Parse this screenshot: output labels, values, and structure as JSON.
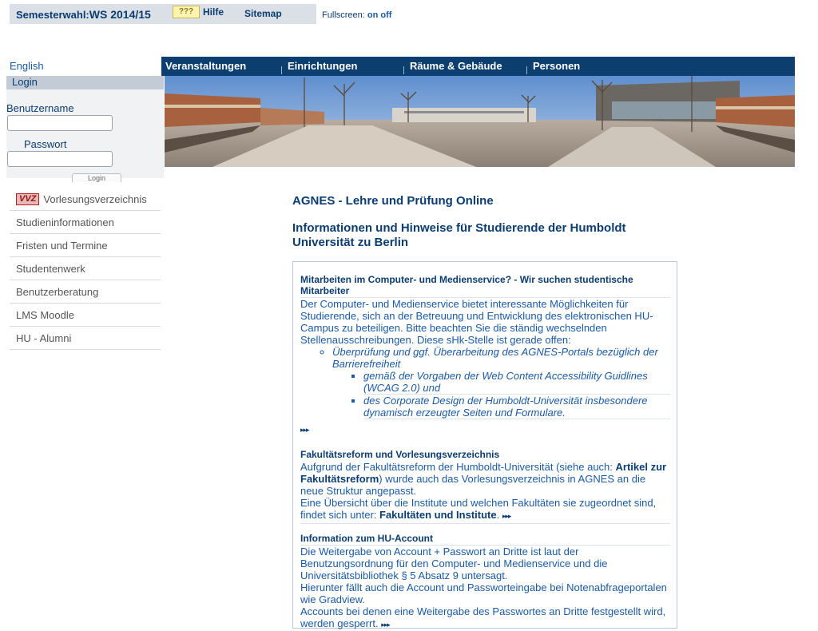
{
  "topbar": {
    "semester_label": "Semesterwahl:",
    "semester_value": "WS 2014/15",
    "help_badge": "???",
    "help_label": "Hilfe",
    "sitemap_label": "Sitemap",
    "fullscreen_label": "Fullscreen:",
    "fullscreen_on": "on",
    "fullscreen_off": "off"
  },
  "language": "English",
  "login": {
    "title": "Login",
    "username_label": "Benutzername",
    "password_label": "Passwort",
    "button_label": "Login"
  },
  "sidenav": {
    "vvz_badge": "VVZ",
    "items": [
      "Vorlesungsverzeichnis",
      "Studieninformationen",
      "Fristen und Termine",
      "Studentenwerk",
      "Benutzerberatung",
      "LMS Moodle",
      "HU - Alumni"
    ]
  },
  "mainnav": [
    "Veranstaltungen",
    "Einrichtungen",
    "Räume & Gebäude",
    "Personen"
  ],
  "content": {
    "title": "AGNES - Lehre und Prüfung Online",
    "subtitle": "Informationen und Hinweise für Studierende der Humboldt Universität zu Berlin"
  },
  "news": [
    {
      "title": "Mitarbeiten im Computer- und Medienservice? - Wir suchen studentische Mitarbeiter",
      "text": "Der Computer- und Medienservice bietet interessante Möglichkeiten für Studierende, sich an der Betreuung und Entwicklung des elektronischen HU-Campus zu beteiligen. Bitte beachten Sie die ständig wechselnden Stellenausschreibungen. Diese sHk-Stelle ist gerade offen:",
      "list_item": "Überprüfung und ggf. Überarbeitung des AGNES-Portals bezüglich der Barrierefreiheit",
      "sub_items": [
        "gemäß der Vorgaben der Web Content Accessibility Guidlines (WCAG 2.0) und",
        "des Corporate Design der Humboldt-Universität insbesondere dynamisch erzeugter Seiten und Formulare."
      ]
    },
    {
      "title": "Fakultätsreform und Vorlesungsverzeichnis",
      "text1": "Aufgrund der Fakultätsreform der Humboldt-Universität (siehe auch: ",
      "link1": "Artikel zur Fakultätsreform",
      "text2": ") wurde auch das Vorlesungsverzeichnis in AGNES an die neue Struktur angepasst.",
      "text3": "Eine Übersicht über die Institute und welchen Fakultäten sie zugeordnet sind, findet sich unter: ",
      "link2": "Fakultäten und Institute"
    },
    {
      "title": "Information zum HU-Account",
      "text1": "Die Weitergabe von Account + Passwort an Dritte ist laut der Benutzungsordnung für den Computer- und Medienservice und die Universitätsbibliothek § 5 Absatz 9 untersagt.",
      "text2": "Hierunter fällt auch die Account und Passworteingabe bei Notenabfrageportalen wie Gradview.",
      "text3": "Accounts bei denen eine Weitergabe des Passwortes an Dritte festgestellt wird, werden gesperrt."
    }
  ],
  "more_arrow": "▸▸▸"
}
